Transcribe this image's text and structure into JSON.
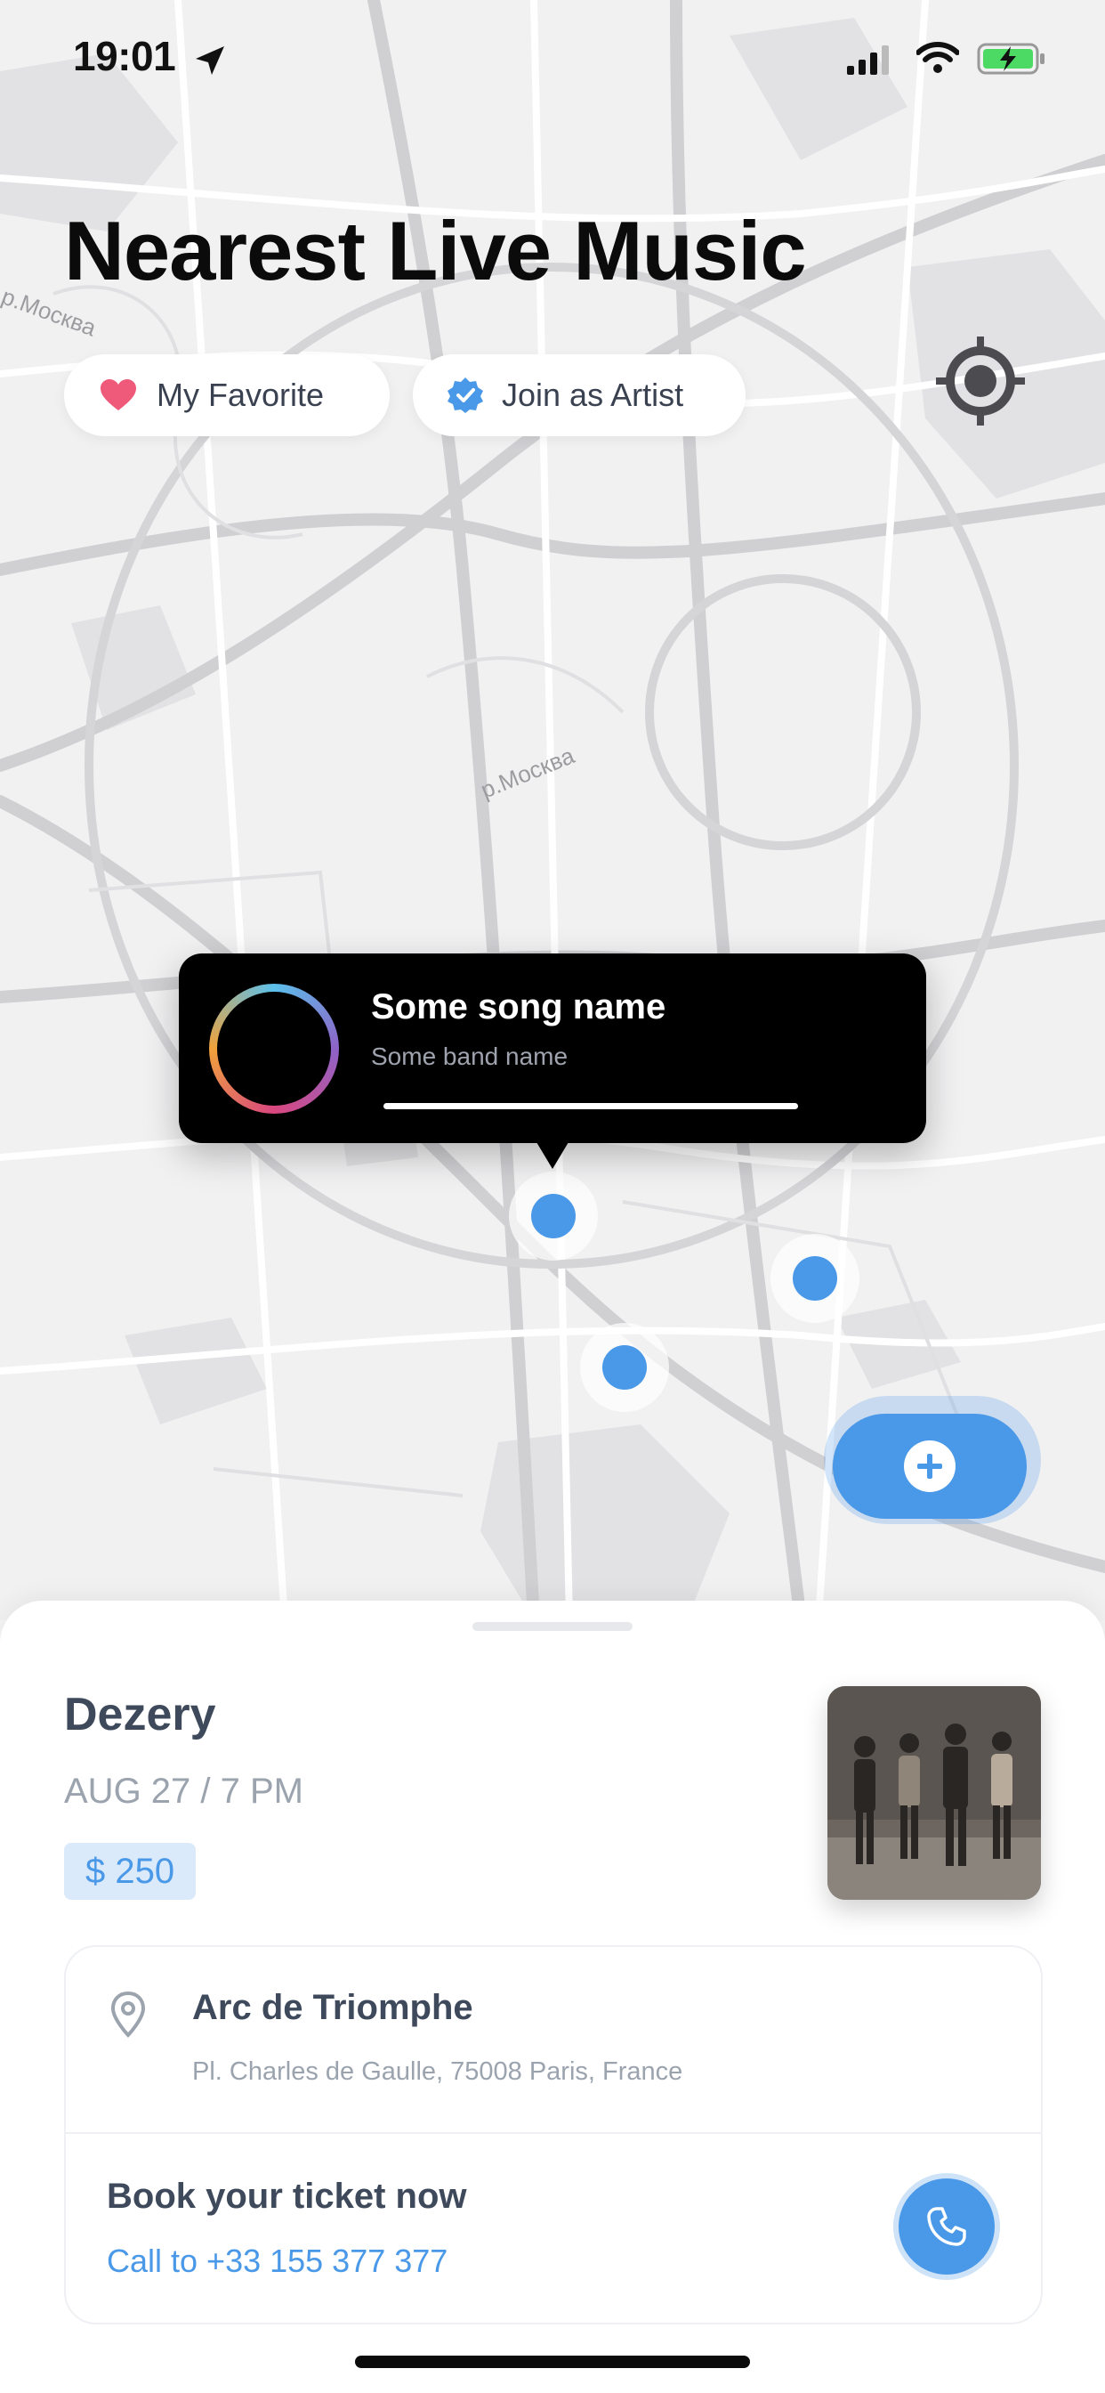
{
  "status_bar": {
    "time": "19:01"
  },
  "header": {
    "title": "Nearest Live Music"
  },
  "chips": [
    {
      "label": "My Favorite",
      "icon": "heart-icon",
      "icon_color": "#ef5a7a"
    },
    {
      "label": "Join as Artist",
      "icon": "verified-badge-icon",
      "icon_color": "#4a98e8"
    }
  ],
  "map": {
    "locate_icon": "crosshair-icon",
    "labels": [
      "р.Москва",
      "р.Москва"
    ]
  },
  "now_playing": {
    "song": "Some song name",
    "band": "Some band name",
    "progress": 1.0
  },
  "fab": {
    "icon": "plus-icon"
  },
  "event": {
    "artist": "Dezery",
    "date": "AUG 27 / 7 PM",
    "price": "$ 250",
    "venue": "Arc de Triomphe",
    "address": "Pl. Charles de Gaulle, 75008 Paris, France",
    "book_title": "Book your ticket now",
    "call_text": "Call to +33 155 377 377"
  },
  "colors": {
    "accent": "#4a98e8",
    "heart": "#ef5a7a",
    "text_dark": "#3e4a5c",
    "text_muted": "#9aa3ae"
  }
}
